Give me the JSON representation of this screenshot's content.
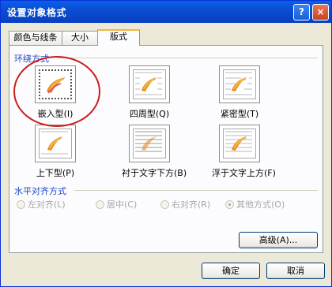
{
  "dialog": {
    "title": "设置对象格式",
    "help_symbol": "?",
    "close_symbol": "×"
  },
  "tabs": [
    {
      "label": "颜色与线条",
      "active": false
    },
    {
      "label": "大小",
      "active": false
    },
    {
      "label": "版式",
      "active": true
    }
  ],
  "wrap_section": {
    "title": "环绕方式",
    "options": [
      {
        "label": "嵌入型(I)",
        "icon": "inline-wrap-icon",
        "selected": true
      },
      {
        "label": "四周型(Q)",
        "icon": "square-wrap-icon",
        "selected": false
      },
      {
        "label": "紧密型(T)",
        "icon": "tight-wrap-icon",
        "selected": false
      },
      {
        "label": "上下型(P)",
        "icon": "top-bottom-wrap-icon",
        "selected": false
      },
      {
        "label": "衬于文字下方(B)",
        "icon": "behind-text-icon",
        "selected": false
      },
      {
        "label": "浮于文字上方(F)",
        "icon": "in-front-of-text-icon",
        "selected": false
      }
    ]
  },
  "align_section": {
    "title": "水平对齐方式",
    "options": [
      {
        "label": "左对齐(L)",
        "checked": false,
        "enabled": false
      },
      {
        "label": "居中(C)",
        "checked": false,
        "enabled": false
      },
      {
        "label": "右对齐(R)",
        "checked": false,
        "enabled": false
      },
      {
        "label": "其他方式(O)",
        "checked": true,
        "enabled": false
      }
    ]
  },
  "buttons": {
    "advanced": "高级(A)...",
    "ok": "确定",
    "cancel": "取消"
  },
  "colors": {
    "title_bar": "#0A4AD0",
    "accent": "#1C49C5",
    "annotation_circle": "#C81E1E"
  }
}
